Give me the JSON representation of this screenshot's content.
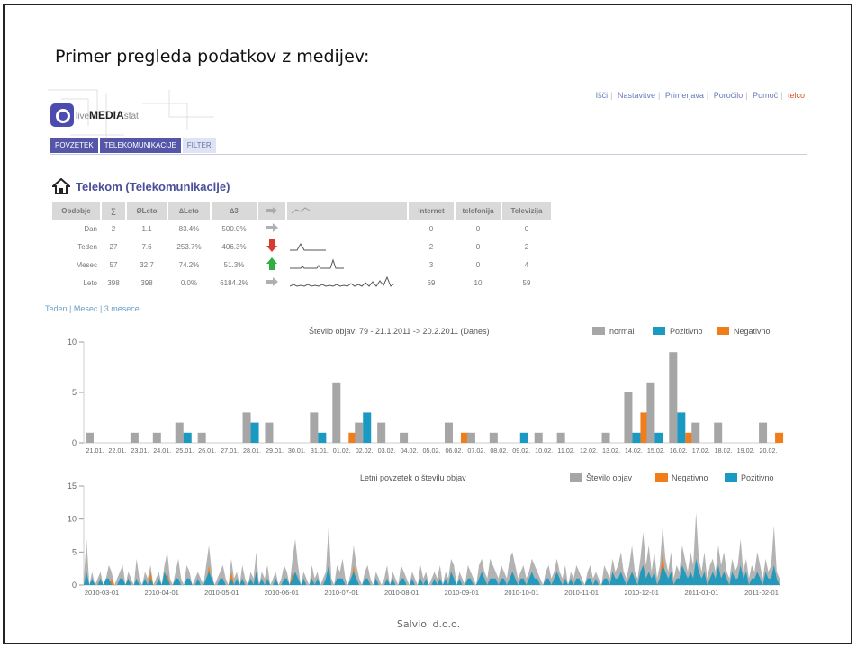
{
  "slide": {
    "headline": "Primer pregleda podatkov z medijev:",
    "footer": "Salviol d.o.o."
  },
  "app": {
    "logo": {
      "live": "live",
      "media": "MEDIA",
      "stat": "stat"
    },
    "top_menu": [
      "Išči",
      "Nastavitve",
      "Primerjava",
      "Poročilo",
      "Pomoč",
      "telco"
    ],
    "tabs": [
      "POVZETEK",
      "TELEKOMUNIKACIJE",
      "FILTER"
    ],
    "section_title": "Telekom (Telekomunikacije)",
    "table": {
      "headers": [
        "Obdobje",
        "∑",
        "ØLeto",
        "∆Leto",
        "∆3",
        "",
        "",
        "Internet",
        "telefonija",
        "Televizija"
      ],
      "rows": [
        {
          "period": "Dan",
          "sum": "2",
          "avg": "1.1",
          "dyear": "83.4%",
          "d3": "500.0%",
          "arrow": "flat",
          "internet": "0",
          "telefonija": "0",
          "televizija": "0"
        },
        {
          "period": "Teden",
          "sum": "27",
          "avg": "7.6",
          "dyear": "253.7%",
          "d3": "406.3%",
          "arrow": "down",
          "internet": "2",
          "telefonija": "0",
          "televizija": "2"
        },
        {
          "period": "Mesec",
          "sum": "57",
          "avg": "32.7",
          "dyear": "74.2%",
          "d3": "51.3%",
          "arrow": "up",
          "internet": "3",
          "telefonija": "0",
          "televizija": "4"
        },
        {
          "period": "Leto",
          "sum": "398",
          "avg": "398",
          "dyear": "0.0%",
          "d3": "6184.2%",
          "arrow": "flat",
          "internet": "69",
          "telefonija": "10",
          "televizija": "59"
        }
      ]
    },
    "range_links": {
      "week": "Teden",
      "month": "Mesec",
      "three_months": "3 mesece",
      "sep": "|"
    }
  },
  "colors": {
    "normal": "#a6a6a6",
    "positive": "#1a9ac2",
    "negative": "#f07d19",
    "accent": "#5556a8"
  },
  "chart_data": [
    {
      "type": "bar",
      "title": "Število objav: 79 - 21.1.2011 -> 20.2.2011 (Danes)",
      "legend_position": "top-right",
      "ylim": [
        0,
        10
      ],
      "yticks": [
        0,
        5,
        10
      ],
      "categories": [
        "21.01.",
        "22.01.",
        "23.01.",
        "24.01.",
        "25.01.",
        "26.01.",
        "27.01.",
        "28.01.",
        "29.01.",
        "30.01.",
        "31.01.",
        "01.02.",
        "02.02.",
        "03.02.",
        "04.02.",
        "05.02.",
        "06.02.",
        "07.02.",
        "08.02.",
        "09.02.",
        "10.02.",
        "11.02.",
        "12.02.",
        "13.02.",
        "14.02.",
        "15.02.",
        "16.02.",
        "17.02.",
        "18.02.",
        "19.02.",
        "20.02."
      ],
      "series": [
        {
          "name": "normal",
          "values": [
            1,
            0,
            1,
            1,
            2,
            1,
            0,
            3,
            2,
            0,
            3,
            6,
            2,
            2,
            1,
            0,
            2,
            1,
            1,
            0,
            1,
            1,
            0,
            1,
            5,
            6,
            9,
            2,
            2,
            0,
            2
          ]
        },
        {
          "name": "Pozitivno",
          "values": [
            0,
            0,
            0,
            0,
            1,
            0,
            0,
            2,
            0,
            0,
            1,
            0,
            3,
            0,
            0,
            0,
            0,
            0,
            0,
            1,
            0,
            0,
            0,
            0,
            1,
            1,
            3,
            0,
            0,
            0,
            0
          ]
        },
        {
          "name": "Negativno",
          "values": [
            0,
            0,
            0,
            0,
            0,
            0,
            0,
            0,
            0,
            0,
            0,
            1,
            0,
            0,
            0,
            0,
            1,
            0,
            0,
            0,
            0,
            0,
            0,
            0,
            3,
            0,
            1,
            0,
            0,
            0,
            1
          ]
        }
      ]
    },
    {
      "type": "area",
      "title": "Letni povzetek o številu objav",
      "legend_position": "top-right",
      "ylim": [
        0,
        15
      ],
      "yticks": [
        0,
        5,
        10,
        15
      ],
      "xticks": [
        "2010-03-01",
        "2010-04-01",
        "2010-05-01",
        "2010-06-01",
        "2010-07-01",
        "2010-08-01",
        "2010-09-01",
        "2010-10-01",
        "2010-11-01",
        "2010-12-01",
        "2011-01-01",
        "2011-02-01"
      ],
      "series": [
        {
          "name": "Število objav",
          "values": [
            1,
            7,
            0,
            2,
            0,
            1,
            2,
            0,
            1,
            3,
            2,
            0,
            1,
            2,
            3,
            0,
            2,
            1,
            0,
            4,
            1,
            0,
            2,
            1,
            3,
            0,
            1,
            2,
            0,
            3,
            5,
            1,
            0,
            2,
            4,
            1,
            0,
            3,
            2,
            0,
            1,
            2,
            1,
            0,
            3,
            6,
            2,
            0,
            1,
            2,
            3,
            1,
            0,
            4,
            1,
            2,
            0,
            3,
            1,
            0,
            2,
            1,
            5,
            0,
            2,
            1,
            3,
            0,
            1,
            2,
            0,
            1,
            3,
            2,
            0,
            4,
            7,
            3,
            0,
            2,
            1,
            0,
            3,
            1,
            2,
            0,
            1,
            2,
            9,
            1,
            0,
            3,
            2,
            4,
            1,
            0,
            2,
            6,
            3,
            1,
            0,
            2,
            3,
            1,
            0,
            2,
            1,
            0,
            1,
            3,
            0,
            2,
            1,
            0,
            3,
            2,
            1,
            0,
            2,
            1,
            0,
            3,
            1,
            2,
            0,
            1,
            2,
            1,
            3,
            0,
            2,
            1,
            4,
            3,
            0,
            2,
            1,
            0,
            3,
            2,
            1,
            0,
            3,
            4,
            2,
            1,
            4,
            3,
            2,
            1,
            3,
            2,
            1,
            4,
            5,
            3,
            1,
            2,
            3,
            1,
            2,
            4,
            3,
            2,
            1,
            0,
            2,
            3,
            1,
            2,
            4,
            2,
            1,
            3,
            0,
            2,
            1,
            3,
            2,
            1,
            0,
            2,
            3,
            1,
            2,
            1,
            0,
            3,
            2,
            1,
            4,
            2,
            3,
            5,
            2,
            1,
            3,
            6,
            2,
            1,
            4,
            8,
            3,
            6,
            2,
            5,
            1,
            3,
            9,
            4,
            2,
            5,
            1,
            3,
            2,
            6,
            4,
            2,
            5,
            3,
            11,
            4,
            2,
            5,
            1,
            3,
            4,
            2,
            6,
            3,
            5,
            2,
            1,
            4,
            2,
            3,
            7,
            2,
            4,
            1,
            3,
            2,
            5,
            3,
            1,
            4,
            2,
            3,
            9,
            2,
            1
          ]
        },
        {
          "name": "Negativno",
          "values": [
            0,
            1,
            0,
            0,
            0,
            0,
            1,
            0,
            0,
            0,
            1,
            0,
            0,
            0,
            0,
            0,
            1,
            0,
            0,
            0,
            0,
            0,
            0,
            0,
            2,
            0,
            0,
            0,
            0,
            0,
            2,
            0,
            0,
            1,
            0,
            0,
            0,
            0,
            1,
            0,
            0,
            0,
            0,
            0,
            0,
            3,
            0,
            0,
            0,
            0,
            1,
            0,
            0,
            2,
            0,
            0,
            0,
            1,
            0,
            0,
            0,
            0,
            2,
            0,
            0,
            0,
            1,
            0,
            0,
            0,
            0,
            0,
            1,
            0,
            0,
            2,
            0,
            1,
            0,
            0,
            0,
            0,
            1,
            0,
            0,
            0,
            0,
            0,
            2,
            0,
            0,
            1,
            0,
            0,
            0,
            0,
            0,
            3,
            0,
            0,
            0,
            0,
            1,
            0,
            0,
            0,
            0,
            0,
            0,
            1,
            0,
            0,
            0,
            0,
            1,
            0,
            0,
            0,
            0,
            0,
            0,
            1,
            0,
            0,
            0,
            0,
            0,
            0,
            1,
            0,
            0,
            0,
            2,
            0,
            0,
            0,
            0,
            0,
            1,
            0,
            0,
            0,
            0,
            1,
            0,
            0,
            1,
            0,
            0,
            0,
            1,
            0,
            0,
            0,
            2,
            1,
            0,
            0,
            1,
            0,
            0,
            1,
            0,
            0,
            0,
            0,
            0,
            1,
            0,
            0,
            2,
            0,
            0,
            1,
            0,
            0,
            0,
            1,
            0,
            0,
            0,
            0,
            1,
            0,
            0,
            0,
            0,
            1,
            0,
            0,
            2,
            0,
            1,
            1,
            0,
            0,
            1,
            2,
            0,
            0,
            1,
            3,
            1,
            2,
            0,
            1,
            0,
            1,
            5,
            1,
            0,
            2,
            0,
            1,
            0,
            2,
            1,
            0,
            2,
            1,
            3,
            1,
            0,
            2,
            0,
            1,
            1,
            0,
            2,
            1,
            2,
            0,
            0,
            1,
            0,
            1,
            2,
            0,
            1,
            0,
            1,
            0,
            2,
            1,
            0,
            1,
            0,
            1,
            3,
            0,
            0
          ]
        },
        {
          "name": "Pozitivno",
          "values": [
            0,
            2,
            0,
            1,
            0,
            0,
            1,
            0,
            1,
            1,
            0,
            0,
            0,
            1,
            1,
            0,
            1,
            0,
            0,
            1,
            0,
            0,
            1,
            0,
            1,
            0,
            0,
            1,
            0,
            2,
            1,
            0,
            0,
            1,
            1,
            0,
            0,
            1,
            1,
            0,
            0,
            1,
            0,
            0,
            1,
            2,
            1,
            0,
            0,
            1,
            1,
            0,
            0,
            1,
            0,
            1,
            0,
            1,
            0,
            0,
            1,
            0,
            2,
            0,
            1,
            0,
            1,
            0,
            0,
            1,
            0,
            0,
            1,
            1,
            0,
            1,
            2,
            1,
            0,
            1,
            0,
            0,
            1,
            0,
            1,
            0,
            0,
            1,
            3,
            0,
            0,
            1,
            1,
            1,
            0,
            0,
            1,
            2,
            1,
            0,
            0,
            1,
            1,
            0,
            0,
            1,
            0,
            0,
            0,
            1,
            0,
            1,
            0,
            0,
            1,
            1,
            0,
            0,
            1,
            0,
            0,
            1,
            0,
            1,
            0,
            0,
            1,
            0,
            1,
            0,
            1,
            0,
            2,
            1,
            0,
            1,
            0,
            0,
            1,
            1,
            0,
            0,
            1,
            2,
            1,
            0,
            1,
            1,
            1,
            0,
            1,
            1,
            0,
            1,
            2,
            1,
            0,
            1,
            1,
            0,
            1,
            2,
            1,
            1,
            0,
            0,
            1,
            1,
            0,
            1,
            2,
            1,
            0,
            1,
            0,
            1,
            0,
            1,
            1,
            0,
            0,
            1,
            1,
            0,
            1,
            0,
            0,
            1,
            1,
            0,
            2,
            1,
            1,
            2,
            1,
            0,
            1,
            2,
            1,
            0,
            2,
            3,
            1,
            2,
            1,
            2,
            0,
            1,
            3,
            2,
            1,
            2,
            0,
            1,
            1,
            3,
            2,
            1,
            2,
            1,
            4,
            2,
            1,
            2,
            0,
            1,
            2,
            1,
            3,
            1,
            2,
            1,
            0,
            2,
            1,
            1,
            3,
            1,
            2,
            0,
            1,
            1,
            2,
            1,
            0,
            2,
            1,
            1,
            3,
            1,
            0
          ]
        }
      ]
    }
  ]
}
